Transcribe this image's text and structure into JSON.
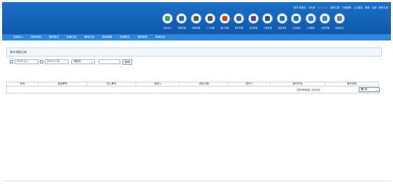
{
  "header": {
    "top_links": [
      "您好 韩爱芬",
      "今天是",
      "2015-3-2",
      "我的位置",
      "行政管理",
      "公共服务",
      "刷新",
      "注销",
      "我的订阅"
    ],
    "modules": [
      {
        "label": "共享办公",
        "icon": "people-icon",
        "color": "#3aa655"
      },
      {
        "label": "流程管理",
        "icon": "flow-icon",
        "color": "#1f67b8"
      },
      {
        "label": "考勤管理",
        "icon": "clock-icon",
        "color": "#555555"
      },
      {
        "label": "个人管理",
        "icon": "power-icon",
        "color": "#555555"
      },
      {
        "label": "客户管理",
        "icon": "crm-icon",
        "color": "#d9381e"
      },
      {
        "label": "库存管理",
        "icon": "stock-icon",
        "color": "#2f63b0"
      },
      {
        "label": "合同管理",
        "icon": "contract-icon",
        "color": "#5a3e9a"
      },
      {
        "label": "日常管理",
        "icon": "daily-icon",
        "color": "#2a4f8a"
      },
      {
        "label": "设备管理",
        "icon": "device-icon",
        "color": "#1d6fc8"
      },
      {
        "label": "汇总报表",
        "icon": "report-icon",
        "color": "#1d6fc8"
      },
      {
        "label": "公共服务",
        "icon": "service-icon",
        "color": "#2a7bd6"
      },
      {
        "label": "文档管理",
        "icon": "doc-icon",
        "color": "#3a7fc8"
      },
      {
        "label": "系统设置",
        "icon": "settings-icon",
        "color": "#6b7f99"
      }
    ]
  },
  "nav": {
    "items": [
      "档案录入",
      "档案检索",
      "借阅登记",
      "档案归还",
      "借阅记录",
      "档案编辑",
      "档案移交",
      "借阅审批",
      "简单查询"
    ]
  },
  "panel": {
    "title": "票本领取记录"
  },
  "filters": {
    "date_start": "2015-3-1",
    "date_end": "2015-3-30",
    "field_select": "领取号",
    "keyword": "",
    "query_button": "查询"
  },
  "table": {
    "columns": [
      "序号",
      "起始票号",
      "终止票号",
      "领用人",
      "领用日期",
      "操作人",
      "操作时间",
      "操作说明"
    ]
  },
  "pager": {
    "summary": "共有0条信息, 分为0页",
    "page_select": "第1页"
  }
}
